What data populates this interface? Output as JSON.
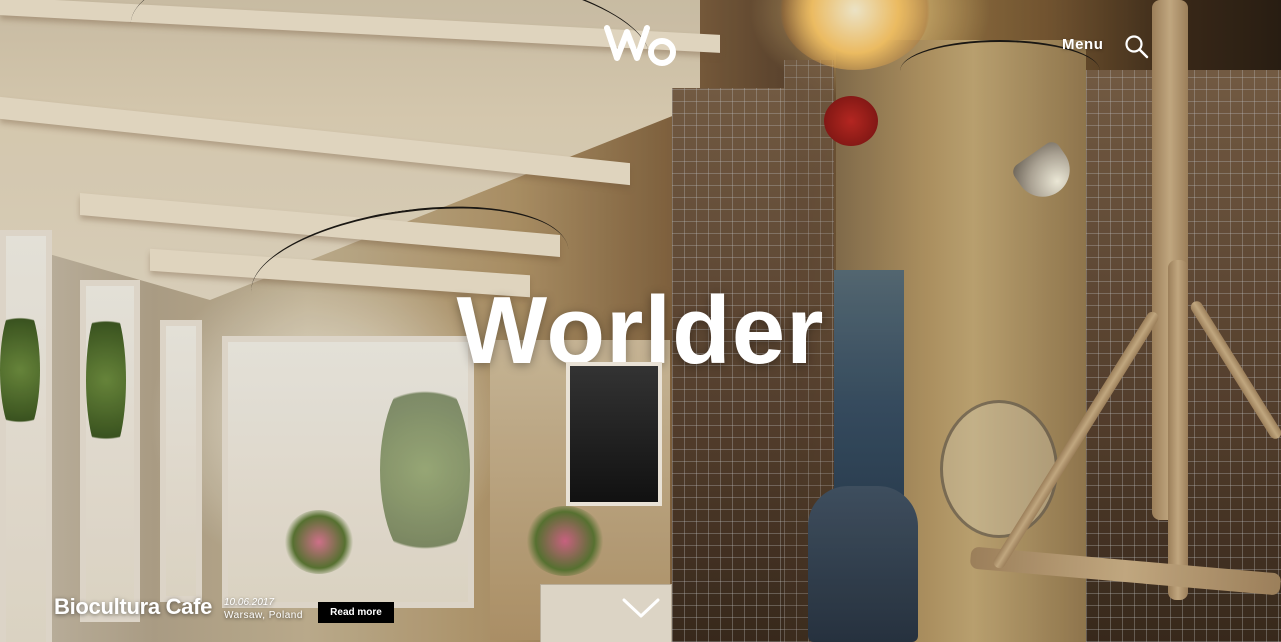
{
  "header": {
    "logo_text": "Wo",
    "menu_label": "Menu"
  },
  "hero": {
    "title": "Worlder"
  },
  "feature": {
    "title": "Biocultura Cafe",
    "date": "10.06.2017",
    "location": "Warsaw, Poland",
    "read_more_label": "Read more"
  },
  "icons": {
    "search": "search-icon",
    "scroll": "chevron-down-icon"
  },
  "colors": {
    "text": "#ffffff",
    "button_bg": "#000000"
  }
}
